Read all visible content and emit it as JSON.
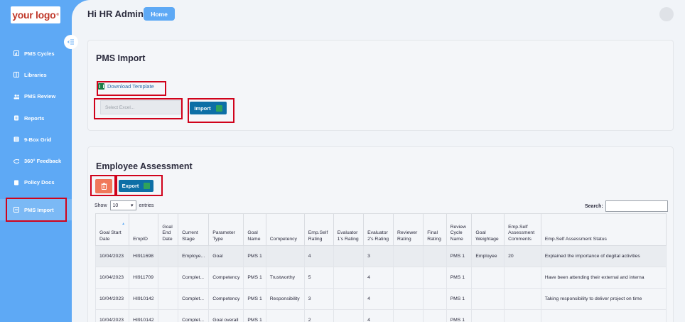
{
  "sidebar": {
    "logo_text": "your logo",
    "logo_mark": "®",
    "items": [
      {
        "label": "PMS Cycles",
        "icon": "chart-icon"
      },
      {
        "label": "Libraries",
        "icon": "book-icon"
      },
      {
        "label": "PMS Review",
        "icon": "users-icon"
      },
      {
        "label": "Reports",
        "icon": "report-icon"
      },
      {
        "label": "9-Box Grid",
        "icon": "grid-icon"
      },
      {
        "label": "360° Feedback",
        "icon": "feedback-icon"
      },
      {
        "label": "Policy Docs",
        "icon": "document-icon"
      },
      {
        "label": "PMS Import",
        "icon": "import-icon",
        "active": true
      }
    ]
  },
  "header": {
    "greeting": "Hi HR Admin",
    "home_label": "Home"
  },
  "import_card": {
    "title": "PMS Import",
    "download_label": "Download Template",
    "file_placeholder": "Select Excel...",
    "import_label": "Import"
  },
  "assessment": {
    "title": "Employee Assessment",
    "export_label": "Export",
    "show_label": "Show",
    "entries_value": "10",
    "entries_label": "entries",
    "search_label": "Search:",
    "columns": [
      "Goal Start Date",
      "EmpID",
      "Goal End Date",
      "Current Stage",
      "Parameter Type",
      "Goal Name",
      "Competency",
      "Emp.Self Rating",
      "Evaluator 1's Rating",
      "Evaluator 2's Rating",
      "Reviewer Rating",
      "Final Rating",
      "Review Cycle Name",
      "Goal Weightage",
      "Emp.Self Assessment Comments",
      "Emp.Self Assessment Status"
    ],
    "rows": [
      [
        "10/04/2023",
        "HI911698",
        "",
        "Employe...",
        "Goal",
        "PMS 1",
        "",
        "4",
        "",
        "3",
        "",
        "",
        "PMS 1",
        "Employee",
        "20",
        "Explained the importance of degital activities"
      ],
      [
        "10/04/2023",
        "HI911709",
        "",
        "Complet...",
        "Competency",
        "PMS 1",
        "Trustworthy",
        "5",
        "",
        "4",
        "",
        "",
        "PMS 1",
        "",
        "",
        "Have been attending their external and interna"
      ],
      [
        "10/04/2023",
        "HI910142",
        "",
        "Complet...",
        "Competency",
        "PMS 1",
        "Responsibility",
        "3",
        "",
        "4",
        "",
        "",
        "PMS 1",
        "",
        "",
        "Taking responsibility to deliver project on time"
      ],
      [
        "10/04/2023",
        "HI910142",
        "",
        "Complet...",
        "Goal overall",
        "PMS 1",
        "",
        "2",
        "",
        "4",
        "",
        "",
        "PMS 1",
        "",
        "",
        ""
      ]
    ]
  },
  "colors": {
    "sidebar": "#5ea9f5",
    "primary_button": "#0d6fa6",
    "delete_button": "#f0785a",
    "highlight_box": "#d0021b"
  }
}
